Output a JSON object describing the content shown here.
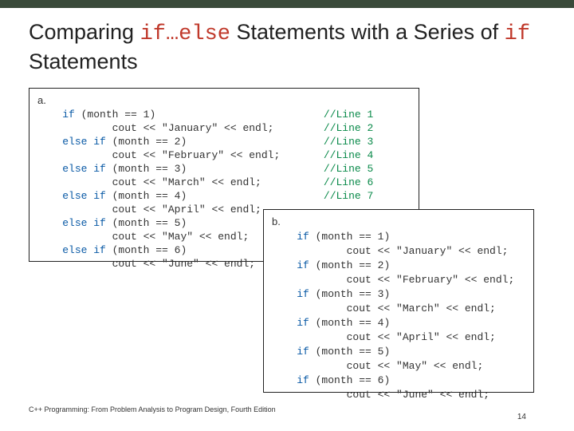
{
  "title": {
    "pre": "Comparing ",
    "code1": "if…else",
    "mid": " Statements with a Series of ",
    "code2": "if",
    "post": " Statements"
  },
  "codeA": {
    "label": "a.",
    "lines": [
      {
        "kw": "if",
        "rest": " (month == 1)",
        "cm": "//Line 1",
        "indent": 0
      },
      {
        "kw": "",
        "rest": "cout << \"January\" << endl;",
        "cm": "//Line 2",
        "indent": 2
      },
      {
        "kw": "else if",
        "rest": " (month == 2)",
        "cm": "//Line 3",
        "indent": 0
      },
      {
        "kw": "",
        "rest": "cout << \"February\" << endl;",
        "cm": "//Line 4",
        "indent": 2
      },
      {
        "kw": "else if",
        "rest": " (month == 3)",
        "cm": "//Line 5",
        "indent": 0
      },
      {
        "kw": "",
        "rest": "cout << \"March\" << endl;",
        "cm": "//Line 6",
        "indent": 2
      },
      {
        "kw": "else if",
        "rest": " (month == 4)",
        "cm": "//Line 7",
        "indent": 0
      },
      {
        "kw": "",
        "rest": "cout << \"April\" << endl;",
        "cm": "",
        "indent": 2
      },
      {
        "kw": "else if",
        "rest": " (month == 5)",
        "cm": "",
        "indent": 0
      },
      {
        "kw": "",
        "rest": "cout << \"May\" << endl;",
        "cm": "",
        "indent": 2
      },
      {
        "kw": "else if",
        "rest": " (month == 6)",
        "cm": "",
        "indent": 0
      },
      {
        "kw": "",
        "rest": "cout << \"June\" << endl;",
        "cm": "",
        "indent": 2
      }
    ]
  },
  "codeB": {
    "label": "b.",
    "lines": [
      {
        "kw": "if",
        "rest": " (month == 1)",
        "indent": 0
      },
      {
        "kw": "",
        "rest": "cout << \"January\" << endl;",
        "indent": 2
      },
      {
        "kw": "if",
        "rest": " (month == 2)",
        "indent": 0
      },
      {
        "kw": "",
        "rest": "cout << \"February\" << endl;",
        "indent": 2
      },
      {
        "kw": "if",
        "rest": " (month == 3)",
        "indent": 0
      },
      {
        "kw": "",
        "rest": "cout << \"March\" << endl;",
        "indent": 2
      },
      {
        "kw": "if",
        "rest": " (month == 4)",
        "indent": 0
      },
      {
        "kw": "",
        "rest": "cout << \"April\" << endl;",
        "indent": 2
      },
      {
        "kw": "if",
        "rest": " (month == 5)",
        "indent": 0
      },
      {
        "kw": "",
        "rest": "cout << \"May\" << endl;",
        "indent": 2
      },
      {
        "kw": "if",
        "rest": " (month == 6)",
        "indent": 0
      },
      {
        "kw": "",
        "rest": "cout << \"June\" << endl;",
        "indent": 2
      }
    ]
  },
  "footer": "C++ Programming: From Problem Analysis to Program Design, Fourth Edition",
  "pageNumber": "14"
}
